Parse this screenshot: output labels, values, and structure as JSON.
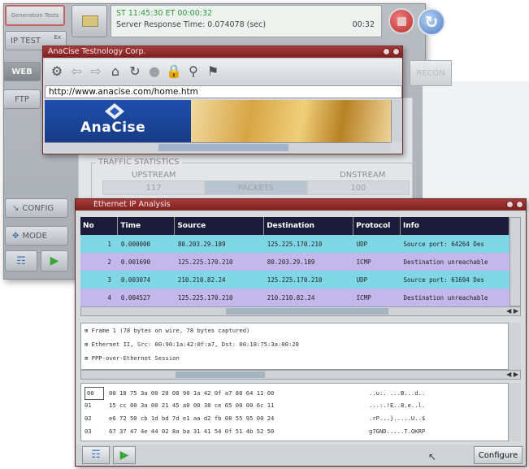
{
  "main_window": {
    "logo_text": "Generation Tests",
    "ip_test_label": "IP TEST",
    "ip_test_small": "Ex",
    "web_label": "WEB",
    "ftp_label": "FTP",
    "status_line1": "ST 11:45:30  ET 00:00:32",
    "status_line2": "Server Response Time: 0.074078 (sec)",
    "status_timer": "00:32",
    "recon_label": "RECON",
    "traffic_title": "TRAFFIC STATISTICS",
    "upstream_label": "UPSTREAM",
    "dnstream_label": "DNSTREAM",
    "traffic_values": [
      "117",
      "PACKETS",
      "100"
    ],
    "config_label": "CONFIG",
    "mode_label": "MODE"
  },
  "browser": {
    "title": "AnaCise Testnology Corp.",
    "url": "http://www.anacise.com/home.htm",
    "logo": "AnaCise"
  },
  "ethernet": {
    "title": "Ethernet IP Analysis",
    "columns": [
      "No",
      "Time",
      "Source",
      "Destination",
      "Protocol",
      "Info"
    ],
    "rows": [
      {
        "no": "1",
        "time": "0.000000",
        "source": "80.203.29.189",
        "destination": "125.225.170.210",
        "protocol": "UDP",
        "info": "Source port: 64264  Des",
        "color": "cyan"
      },
      {
        "no": "2",
        "time": "0.001690",
        "source": "125.225.170.210",
        "destination": "80.203.29.189",
        "protocol": "ICMP",
        "info": "Destination unreachable",
        "color": "purple"
      },
      {
        "no": "3",
        "time": "0.003074",
        "source": "210.210.82.24",
        "destination": "125.225.170.210",
        "protocol": "UDP",
        "info": "Source port: 61694  Des",
        "color": "cyan"
      },
      {
        "no": "4",
        "time": "0.004527",
        "source": "125.225.170.210",
        "destination": "210.210.82.24",
        "protocol": "ICMP",
        "info": "Destination unreachable",
        "color": "purple"
      }
    ],
    "details": [
      "⊞ Frame 1 (78 bytes on wire, 78 bytes captured)",
      "⊞ Ethernet II, Src: 00:90:1a:42:0f:a7, Dst: 00:18:75:3a:00:20",
      "⊞ PPP-over-Ethernet Session"
    ],
    "hex_rows": [
      {
        "offset": "00",
        "bytes": "00 18 75 3a 00 20 00 90 1a 42 0f a7 88 64 11 00",
        "ascii": "..u:. ...B...d.."
      },
      {
        "offset": "01",
        "bytes": "15 cc 00 3a 00 21 45 a0 00 38 ce 65 00 00 6c 11",
        "ascii": "...:.!E..8.e..l."
      },
      {
        "offset": "02",
        "bytes": "e6 72 50 cb 1d bd 7d e1 aa d2 fb 08 55 95 00 24",
        "ascii": ".rP...}.....U..$"
      },
      {
        "offset": "03",
        "bytes": "67 37 47 4e 44 02 8a ba 31 41 54 0f 51 4b 52 50",
        "ascii": "g7GND.....T.QKRP"
      }
    ],
    "configure_label": "Configure"
  }
}
